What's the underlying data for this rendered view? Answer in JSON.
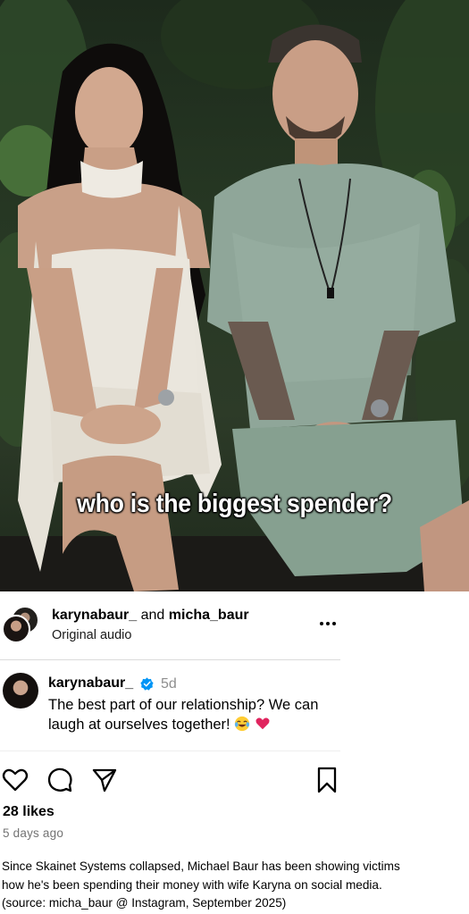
{
  "video": {
    "caption": "who is the biggest spender?"
  },
  "post": {
    "author_primary": "karynabaur_",
    "author_joiner": "and",
    "author_secondary": "micha_baur",
    "audio_label": "Original audio",
    "more_icon": "more-horizontal-icon"
  },
  "comment": {
    "username": "karynabaur_",
    "verified_icon": "verified-badge-icon",
    "time": "5d",
    "text": "The best part of our relationship? We can laugh at ourselves together!",
    "emojis": [
      "face-with-tears-of-joy-icon",
      "heart-icon"
    ]
  },
  "actions": {
    "icons": [
      "heart-icon",
      "comment-icon",
      "share-icon",
      "bookmark-icon"
    ],
    "likes": "28 likes",
    "posted": "5 days ago"
  },
  "footnote": {
    "line1": "Since Skainet Systems collapsed, Michael Baur has been showing victims",
    "line2": "how he's been spending their money with wife Karyna on social media.",
    "line3": "(source: micha_baur @ Instagram, September 2025)"
  },
  "colors": {
    "verified_blue": "#0095f6",
    "secondary_text": "#8e8e8e",
    "heart_red": "#e0245e"
  }
}
